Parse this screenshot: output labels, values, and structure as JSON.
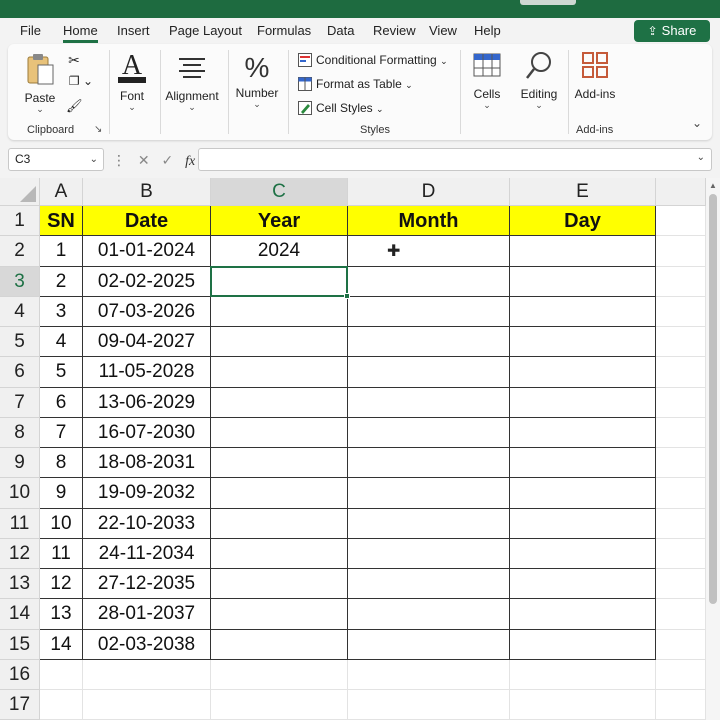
{
  "menu": {
    "tabs": [
      "File",
      "Home",
      "Insert",
      "Page Layout",
      "Formulas",
      "Data",
      "Review",
      "View",
      "Help"
    ],
    "active_tab": "Home",
    "share_label": "Share"
  },
  "ribbon": {
    "clipboard": {
      "paste_label": "Paste",
      "group_label": "Clipboard"
    },
    "font_label": "Font",
    "alignment_label": "Alignment",
    "number_label": "Number",
    "styles": {
      "conditional_formatting": "Conditional Formatting",
      "format_as_table": "Format as Table",
      "cell_styles": "Cell Styles",
      "group_label": "Styles"
    },
    "cells_label": "Cells",
    "editing_label": "Editing",
    "addins": {
      "button_label": "Add-ins",
      "group_label": "Add-ins"
    }
  },
  "formula_bar": {
    "name_box": "C3",
    "fx_label": "fx",
    "value": ""
  },
  "sheet": {
    "columns": [
      "A",
      "B",
      "C",
      "D",
      "E"
    ],
    "rows": [
      "1",
      "2",
      "3",
      "4",
      "5",
      "6",
      "7",
      "8",
      "9",
      "10",
      "11",
      "12",
      "13",
      "14",
      "15",
      "16",
      "17"
    ],
    "headers": [
      "SN",
      "Date",
      "Year",
      "Month",
      "Day"
    ],
    "data": [
      [
        "1",
        "01-01-2024",
        "2024",
        "",
        ""
      ],
      [
        "2",
        "02-02-2025",
        "",
        "",
        ""
      ],
      [
        "3",
        "07-03-2026",
        "",
        "",
        ""
      ],
      [
        "4",
        "09-04-2027",
        "",
        "",
        ""
      ],
      [
        "5",
        "11-05-2028",
        "",
        "",
        ""
      ],
      [
        "6",
        "13-06-2029",
        "",
        "",
        ""
      ],
      [
        "7",
        "16-07-2030",
        "",
        "",
        ""
      ],
      [
        "8",
        "18-08-2031",
        "",
        "",
        ""
      ],
      [
        "9",
        "19-09-2032",
        "",
        "",
        ""
      ],
      [
        "10",
        "22-10-2033",
        "",
        "",
        ""
      ],
      [
        "11",
        "24-11-2034",
        "",
        "",
        ""
      ],
      [
        "12",
        "27-12-2035",
        "",
        "",
        ""
      ],
      [
        "13",
        "28-01-2037",
        "",
        "",
        ""
      ],
      [
        "14",
        "02-03-2038",
        "",
        "",
        ""
      ]
    ],
    "active_cell": "C3"
  },
  "colors": {
    "accent": "#1e7145",
    "header_fill": "#ffff00"
  }
}
